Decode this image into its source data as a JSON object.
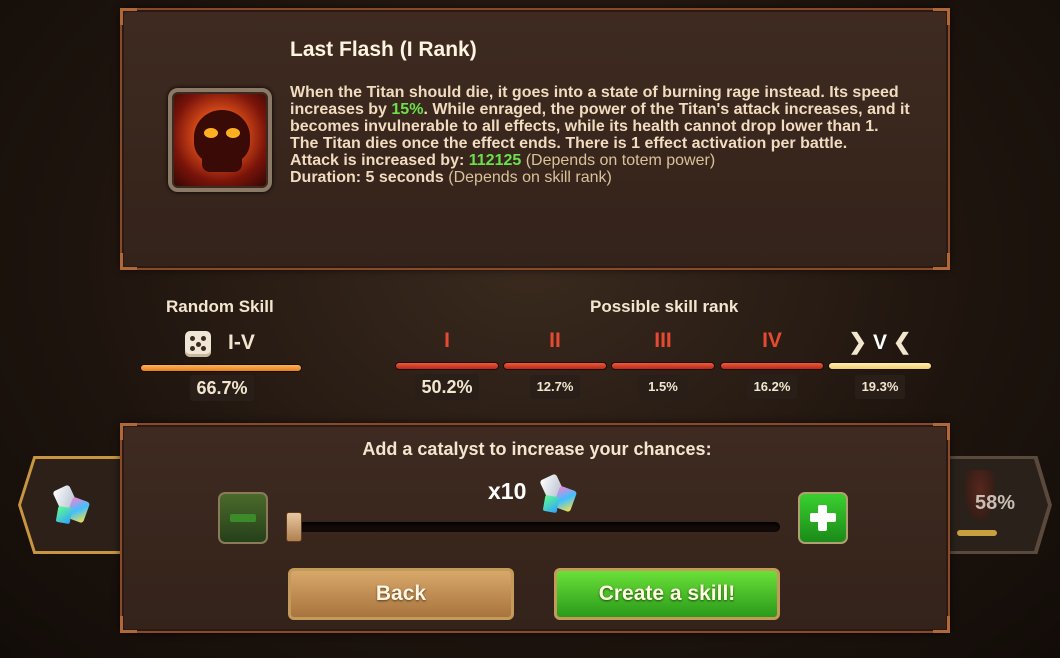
{
  "skill": {
    "title": "Last Flash (I Rank)",
    "desc_1": "When the Titan should die, it goes into a state of burning rage instead. Its speed increases by ",
    "speed_pct": "15%",
    "desc_2": ". While enraged, the power of the Titan's attack increases, and it becomes invulnerable to all effects, while its health cannot drop lower than 1. The Titan dies once the effect ends. There is 1 effect activation per battle.",
    "attack_label": "Attack is increased by: ",
    "attack_value": "112125",
    "attack_note": " (Depends on totem power)",
    "duration_label": "Duration: 5 seconds",
    "duration_note": " (Depends on skill rank)"
  },
  "random": {
    "label": "Random Skill",
    "range": "I-V",
    "percent": "66.7%"
  },
  "possible": {
    "label": "Possible skill rank",
    "ranks": [
      {
        "name": "I",
        "percent": "50.2%"
      },
      {
        "name": "II",
        "percent": "12.7%"
      },
      {
        "name": "III",
        "percent": "1.5%"
      },
      {
        "name": "IV",
        "percent": "16.2%"
      },
      {
        "name": "V",
        "percent": "19.3%"
      }
    ],
    "selected_rank": "V"
  },
  "catalyst": {
    "label": "Add a catalyst to increase your chances:",
    "count": "x10",
    "slider_fraction": 0.0
  },
  "side": {
    "right_percent": "58%"
  },
  "buttons": {
    "back": "Back",
    "create": "Create a skill!"
  },
  "colors": {
    "highlight_green": "#6be04a",
    "rank_red": "#e64a32",
    "random_bar": "#f09040",
    "selected_bar": "#f8e0a0"
  },
  "icons": {
    "skill": "flaming-skull-icon",
    "random": "dice-icon",
    "catalyst": "crystal-icon",
    "minus": "minus-icon",
    "plus": "plus-icon"
  }
}
